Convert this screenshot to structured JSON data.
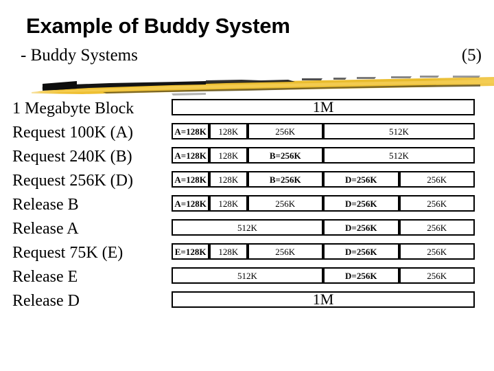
{
  "header": {
    "title": "Example of Buddy System",
    "subtitle": "- Buddy Systems",
    "page_number": "(5)",
    "brush_color": "#EFC033",
    "brush_accent_color": "#121212"
  },
  "labels": [
    "1 Megabyte Block",
    "Request 100K (A)",
    "Request 240K (B)",
    "Request 256K (D)",
    "Release B",
    "Release A",
    "Request 75K (E)",
    "Release E",
    "Release D"
  ],
  "diagram": {
    "total_width_units": 1024,
    "rows": [
      {
        "label": "1 Megabyte Block",
        "cells": [
          {
            "text": "1M",
            "start": 0,
            "size": 1024,
            "allocated": false,
            "big": true
          }
        ]
      },
      {
        "label": "Request 100K (A)",
        "cells": [
          {
            "text": "A=128K",
            "start": 0,
            "size": 128,
            "allocated": true,
            "big": false
          },
          {
            "text": "128K",
            "start": 128,
            "size": 128,
            "allocated": false,
            "big": false
          },
          {
            "text": "256K",
            "start": 256,
            "size": 256,
            "allocated": false,
            "big": false
          },
          {
            "text": "512K",
            "start": 512,
            "size": 512,
            "allocated": false,
            "big": false
          }
        ]
      },
      {
        "label": "Request 240K (B)",
        "cells": [
          {
            "text": "A=128K",
            "start": 0,
            "size": 128,
            "allocated": true,
            "big": false
          },
          {
            "text": "128K",
            "start": 128,
            "size": 128,
            "allocated": false,
            "big": false
          },
          {
            "text": "B=256K",
            "start": 256,
            "size": 256,
            "allocated": true,
            "big": false
          },
          {
            "text": "512K",
            "start": 512,
            "size": 512,
            "allocated": false,
            "big": false
          }
        ]
      },
      {
        "label": "Request 256K (D)",
        "cells": [
          {
            "text": "A=128K",
            "start": 0,
            "size": 128,
            "allocated": true,
            "big": false
          },
          {
            "text": "128K",
            "start": 128,
            "size": 128,
            "allocated": false,
            "big": false
          },
          {
            "text": "B=256K",
            "start": 256,
            "size": 256,
            "allocated": true,
            "big": false
          },
          {
            "text": "D=256K",
            "start": 512,
            "size": 256,
            "allocated": true,
            "big": false
          },
          {
            "text": "256K",
            "start": 768,
            "size": 256,
            "allocated": false,
            "big": false
          }
        ]
      },
      {
        "label": "Release B",
        "cells": [
          {
            "text": "A=128K",
            "start": 0,
            "size": 128,
            "allocated": true,
            "big": false
          },
          {
            "text": "128K",
            "start": 128,
            "size": 128,
            "allocated": false,
            "big": false
          },
          {
            "text": "256K",
            "start": 256,
            "size": 256,
            "allocated": false,
            "big": false
          },
          {
            "text": "D=256K",
            "start": 512,
            "size": 256,
            "allocated": true,
            "big": false
          },
          {
            "text": "256K",
            "start": 768,
            "size": 256,
            "allocated": false,
            "big": false
          }
        ]
      },
      {
        "label": "Release A",
        "cells": [
          {
            "text": "512K",
            "start": 0,
            "size": 512,
            "allocated": false,
            "big": false
          },
          {
            "text": "D=256K",
            "start": 512,
            "size": 256,
            "allocated": true,
            "big": false
          },
          {
            "text": "256K",
            "start": 768,
            "size": 256,
            "allocated": false,
            "big": false
          }
        ]
      },
      {
        "label": "Request 75K (E)",
        "cells": [
          {
            "text": "E=128K",
            "start": 0,
            "size": 128,
            "allocated": true,
            "big": false
          },
          {
            "text": "128K",
            "start": 128,
            "size": 128,
            "allocated": false,
            "big": false
          },
          {
            "text": "256K",
            "start": 256,
            "size": 256,
            "allocated": false,
            "big": false
          },
          {
            "text": "D=256K",
            "start": 512,
            "size": 256,
            "allocated": true,
            "big": false
          },
          {
            "text": "256K",
            "start": 768,
            "size": 256,
            "allocated": false,
            "big": false
          }
        ]
      },
      {
        "label": "Release E",
        "cells": [
          {
            "text": "512K",
            "start": 0,
            "size": 512,
            "allocated": false,
            "big": false
          },
          {
            "text": "D=256K",
            "start": 512,
            "size": 256,
            "allocated": true,
            "big": false
          },
          {
            "text": "256K",
            "start": 768,
            "size": 256,
            "allocated": false,
            "big": false
          }
        ]
      },
      {
        "label": "Release D",
        "cells": [
          {
            "text": "1M",
            "start": 0,
            "size": 1024,
            "allocated": false,
            "big": true
          }
        ]
      }
    ]
  }
}
